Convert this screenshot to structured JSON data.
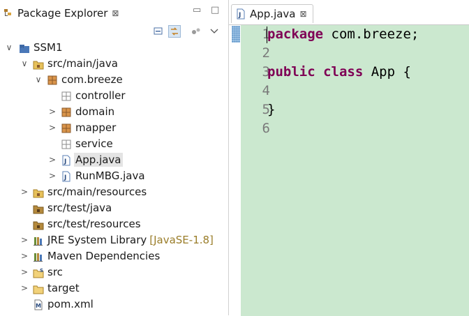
{
  "explorer": {
    "title": "Package Explorer",
    "close": "⊠",
    "minimize": "▭",
    "maximize": "□",
    "tree": [
      {
        "label": "SSM1",
        "chevron": "∨"
      },
      {
        "label": "src/main/java",
        "chevron": "∨"
      },
      {
        "label": "com.breeze",
        "chevron": "∨"
      },
      {
        "label": "controller",
        "chevron": ""
      },
      {
        "label": "domain",
        "chevron": ">"
      },
      {
        "label": "mapper",
        "chevron": ">"
      },
      {
        "label": "service",
        "chevron": ""
      },
      {
        "label": "App.java",
        "chevron": ">"
      },
      {
        "label": "RunMBG.java",
        "chevron": ">"
      },
      {
        "label": "src/main/resources",
        "chevron": ">"
      },
      {
        "label": "src/test/java",
        "chevron": ""
      },
      {
        "label": "src/test/resources",
        "chevron": ""
      },
      {
        "label": "JRE System Library",
        "chevron": ">",
        "decoration": "[JavaSE-1.8]"
      },
      {
        "label": "Maven Dependencies",
        "chevron": ">"
      },
      {
        "label": "src",
        "chevron": ">"
      },
      {
        "label": "target",
        "chevron": ">"
      },
      {
        "label": "pom.xml",
        "chevron": ""
      }
    ]
  },
  "editor": {
    "tab_title": "App.java",
    "close": "⊠",
    "line_numbers": [
      "1",
      "2",
      "3",
      "4",
      "5",
      "6"
    ],
    "lines": [
      {
        "kw1": "package",
        "rest": " com.breeze;"
      },
      {
        "kw1": "",
        "rest": ""
      },
      {
        "kw1": "public",
        "kw2": "class",
        "rest": " App {"
      },
      {
        "kw1": "",
        "rest": ""
      },
      {
        "kw1": "",
        "rest": "}"
      },
      {
        "kw1": "",
        "rest": ""
      }
    ]
  },
  "colors": {
    "editor_bg": "#cbe8cf",
    "keyword": "#7f0055",
    "selection": "#e4e4e4",
    "decoration": "#9a7d29"
  }
}
